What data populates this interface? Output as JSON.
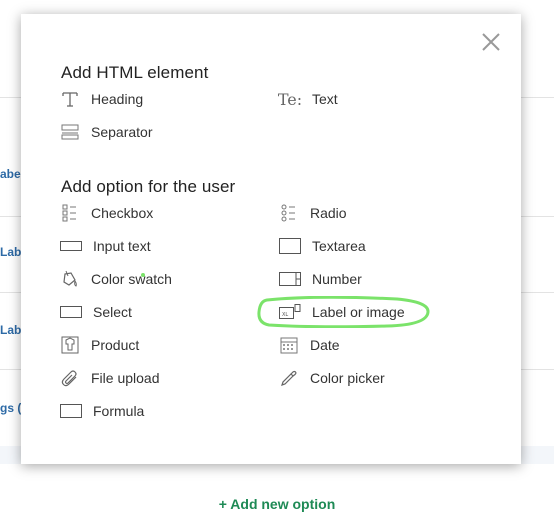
{
  "background": {
    "row_labels": [
      "abe",
      "Lab",
      "Lab",
      "gs ("
    ],
    "add_new_option": "+ Add new option"
  },
  "modal": {
    "close_icon": "close-icon",
    "html_section": {
      "title": "Add HTML element",
      "items": [
        {
          "label": "Heading",
          "icon": "heading-icon"
        },
        {
          "label": "Text",
          "icon": "text-icon"
        },
        {
          "label": "Separator",
          "icon": "separator-icon"
        }
      ]
    },
    "user_section": {
      "title": "Add option for the user",
      "items": [
        {
          "label": "Checkbox",
          "icon": "checkbox-icon"
        },
        {
          "label": "Radio",
          "icon": "radio-icon"
        },
        {
          "label": "Input text",
          "icon": "input-text-icon"
        },
        {
          "label": "Textarea",
          "icon": "textarea-icon"
        },
        {
          "label": "Color swatch",
          "icon": "color-swatch-icon"
        },
        {
          "label": "Number",
          "icon": "number-icon"
        },
        {
          "label": "Select",
          "icon": "select-icon"
        },
        {
          "label": "Label or image",
          "icon": "label-image-icon"
        },
        {
          "label": "Product",
          "icon": "product-icon"
        },
        {
          "label": "Date",
          "icon": "date-icon"
        },
        {
          "label": "File upload",
          "icon": "file-upload-icon"
        },
        {
          "label": "Color picker",
          "icon": "color-picker-icon"
        },
        {
          "label": "Formula",
          "icon": "formula-icon"
        }
      ]
    },
    "highlight_color": "#7be36a"
  }
}
